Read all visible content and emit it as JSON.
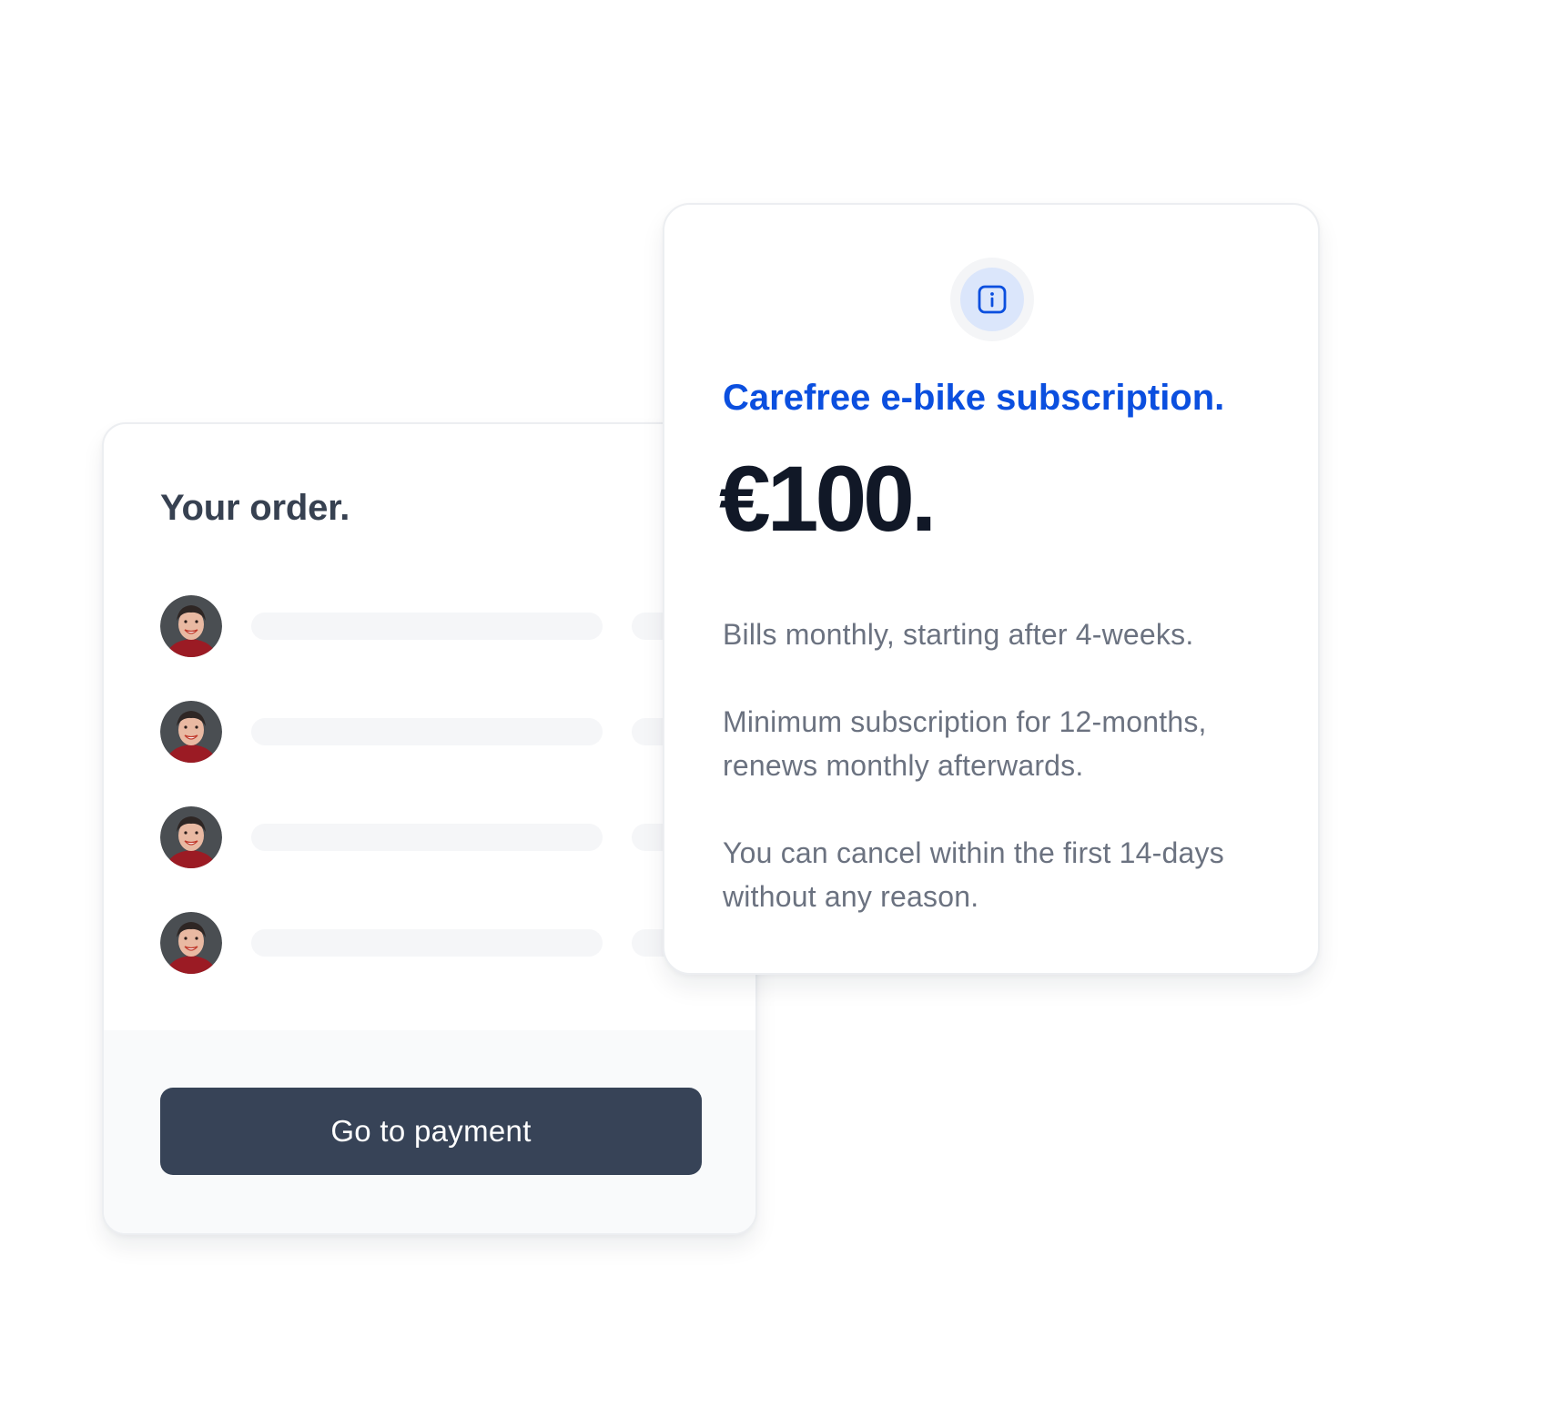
{
  "order": {
    "title": "Your order.",
    "items": [
      {
        "avatar": "customer-avatar"
      },
      {
        "avatar": "customer-avatar"
      },
      {
        "avatar": "customer-avatar"
      },
      {
        "avatar": "customer-avatar"
      }
    ],
    "payment_button_label": "Go to payment"
  },
  "subscription": {
    "icon": "info-icon",
    "title": "Carefree e-bike subscription.",
    "price": "€100.",
    "details": [
      "Bills monthly, starting after 4-weeks.",
      "Minimum subscription for 12-months, renews monthly afterwards.",
      "You can cancel within the first 14-days without any reason."
    ]
  },
  "colors": {
    "accent": "#0b4fdf",
    "button": "#374357",
    "heading": "#374151",
    "price": "#111827",
    "body_text": "#6b7280",
    "icon_badge": "#dbe6fb"
  }
}
